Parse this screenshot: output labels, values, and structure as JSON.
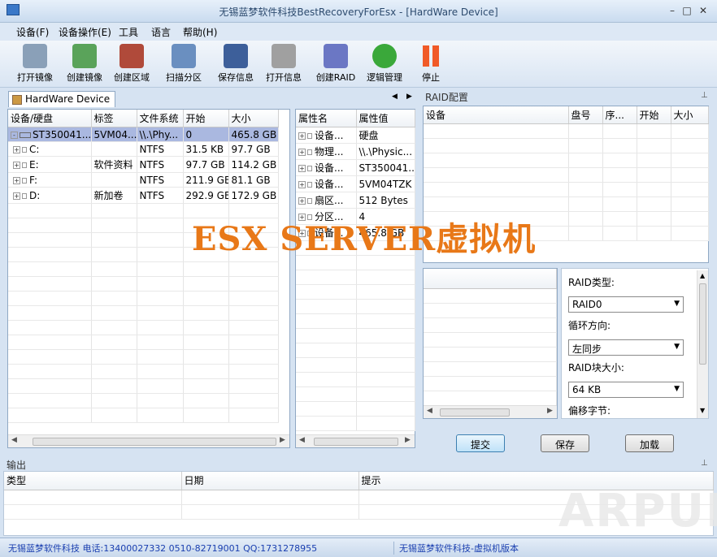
{
  "window": {
    "title": "无锡蓝梦软件科技BestRecoveryForEsx - [HardWare Device]",
    "min": "–",
    "restore": "□",
    "close": "✕"
  },
  "menu": [
    "设备(F)",
    "设备操作(E)",
    "工具",
    "语言",
    "帮助(H)"
  ],
  "toolbar": [
    {
      "label": "打开镜像",
      "icon": "disk-stack-icon",
      "color": "#8aa0b8"
    },
    {
      "label": "创建镜像",
      "icon": "monitor-image-icon",
      "color": "#5aa35a"
    },
    {
      "label": "创建区域",
      "icon": "gear-disk-icon",
      "color": "#b04a3a"
    },
    {
      "label": "扫描分区",
      "icon": "scan-disk-icon",
      "color": "#6a8fc0"
    },
    {
      "label": "保存信息",
      "icon": "floppy-icon",
      "color": "#3d5f9a"
    },
    {
      "label": "打开信息",
      "icon": "open-drive-icon",
      "color": "#a0a0a0"
    },
    {
      "label": "创建RAID",
      "icon": "raid-books-icon",
      "color": "#6b77c4"
    },
    {
      "label": "逻辑管理",
      "icon": "question-arrow-icon",
      "color": "#3aa83a"
    },
    {
      "label": "停止",
      "icon": "pause-icon",
      "color": "#f05a28"
    }
  ],
  "device_tab": {
    "label": "HardWare Device",
    "nav_left": "◀",
    "nav_right": "▶"
  },
  "device_grid": {
    "headers": [
      "设备/硬盘",
      "标签",
      "文件系统",
      "开始",
      "大小"
    ],
    "rows": [
      [
        "ST350041...",
        "5VM04...",
        "\\\\.\\Phy...",
        "0",
        "465.8 GB"
      ],
      [
        "C:",
        "",
        "NTFS",
        "31.5 KB",
        "97.7 GB"
      ],
      [
        "E:",
        "软件资料",
        "NTFS",
        "97.7 GB",
        "114.2 GB"
      ],
      [
        "F:",
        "",
        "NTFS",
        "211.9 GB",
        "81.1 GB"
      ],
      [
        "D:",
        "新加卷",
        "NTFS",
        "292.9 GB",
        "172.9 GB"
      ]
    ]
  },
  "prop_grid": {
    "headers": [
      "属性名",
      "属性值"
    ],
    "rows": [
      [
        "设备...",
        "硬盘"
      ],
      [
        "物理...",
        "\\\\.\\Physic..."
      ],
      [
        "设备...",
        "ST350041..."
      ],
      [
        "设备...",
        "5VM04TZK"
      ],
      [
        "扇区...",
        "512 Bytes"
      ],
      [
        "分区...",
        "4"
      ],
      [
        "设备...",
        "465.8 GB"
      ]
    ]
  },
  "raid": {
    "title": "RAID配置",
    "headers": [
      "设备",
      "盘号",
      "序...",
      "开始",
      "大小"
    ],
    "type_label": "RAID类型:",
    "type_value": "RAID0",
    "dir_label": "循环方向:",
    "dir_value": "左同步",
    "block_label": "RAID块大小:",
    "block_value": "64 KB",
    "offset_label": "偏移字节:",
    "submit": "提交",
    "save": "保存",
    "load": "加载"
  },
  "output": {
    "title": "输出",
    "headers": [
      "类型",
      "日期",
      "提示"
    ]
  },
  "watermark": "ESX SERVER虚拟机",
  "brand_watermark": "ARPUN",
  "status": {
    "left": "无锡蓝梦软件科技 电话:13400027332 0510-82719001 QQ:1731278955",
    "right": "无锡蓝梦软件科技-虚拟机版本"
  },
  "colors": {
    "selected_row": "#aab8e0",
    "accent": "#e87818"
  }
}
